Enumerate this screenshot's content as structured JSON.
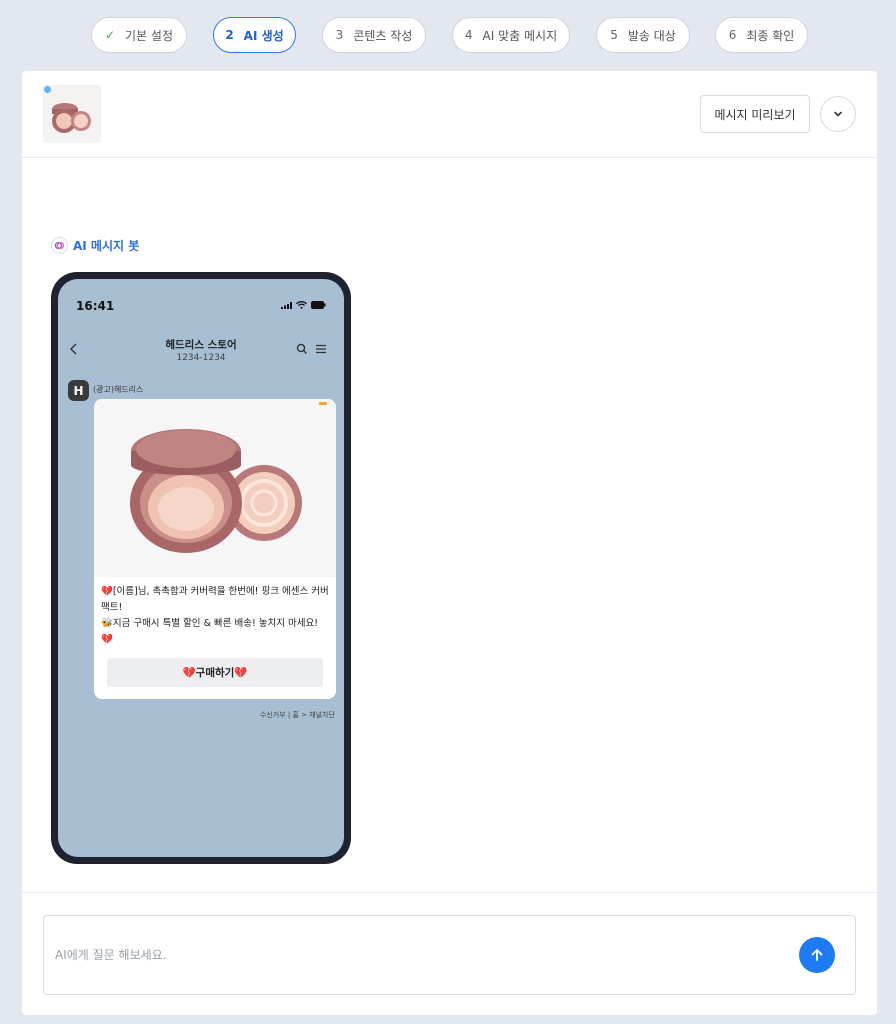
{
  "stepper": {
    "steps": [
      {
        "num": "✓",
        "label": "기본 설정",
        "state": "done"
      },
      {
        "num": "2",
        "label": "AI 생성",
        "state": "active"
      },
      {
        "num": "3",
        "label": "콘텐츠 작성",
        "state": "pending"
      },
      {
        "num": "4",
        "label": "AI 맞춤 메시지",
        "state": "pending"
      },
      {
        "num": "5",
        "label": "발송 대상",
        "state": "pending"
      },
      {
        "num": "6",
        "label": "최종 확인",
        "state": "pending"
      }
    ]
  },
  "header": {
    "preview_label": "메시지 미리보기",
    "thumbnail_icon": "cushion-compact-thumbnail",
    "toggle_icon": "chevron-down-icon"
  },
  "bot": {
    "label": "AI 메시지 봇",
    "icon": "ai-bot-icon"
  },
  "phone": {
    "status_time": "16:41",
    "chat_title": "헤드리스 스토어",
    "chat_number": "1234-1234",
    "sender_initial": "H",
    "sender_name": "(광고)헤드리스",
    "message_lines": [
      "💔[이름]님, 촉촉함과 커버력을 한번에! 핑크 에센스 커버 팩트!",
      "🐝지금 구매시 특별 할인 & 빠른 배송! 놓치지 마세요! 💔"
    ],
    "buy_button": "💔구매하기💔",
    "opt_out": "수신거부 | 홈 > 채널차단"
  },
  "footer": {
    "ask_placeholder": "AI에게 질문 해보세요.",
    "send_icon": "arrow-up-icon"
  },
  "colors": {
    "accent": "#1f7af5",
    "page_bg": "#e3e8f0",
    "chat_bg": "#a8bfd3",
    "phone_frame": "#1f2330"
  }
}
